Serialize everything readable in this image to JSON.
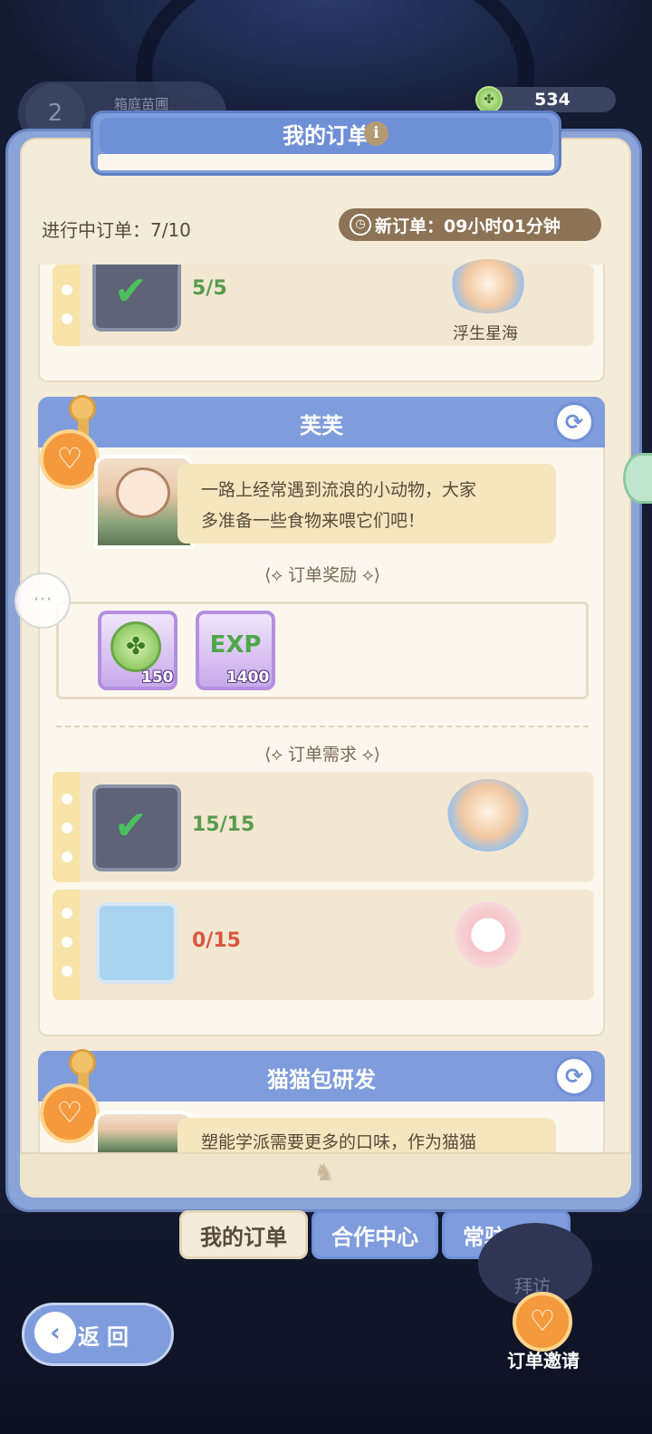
{
  "header": {
    "level": "2",
    "level_name": "箱庭苗圃",
    "currency_value": "534",
    "title": "我的订单",
    "info_label": "i"
  },
  "status": {
    "in_progress": "进行中订单：7/10",
    "new_order_timer": "新订单：09小时01分钟"
  },
  "top_card": {
    "requirement_count": "5/5",
    "giver_name": "浮生星海"
  },
  "order_card": {
    "title": "芙芙",
    "message_line1": "一路上经常遇到流浪的小动物，大家",
    "message_line2": "多准备一些食物来喂它们吧！",
    "reward_section_label": "订单奖励",
    "rewards": [
      {
        "icon": "clover-coin-icon",
        "quantity": "150"
      },
      {
        "icon": "exp-clover-icon",
        "label": "EXP",
        "quantity": "1400"
      }
    ],
    "requirement_section_label": "订单需求",
    "requirements": [
      {
        "icon": "turnip-icon",
        "count": "15/15",
        "complete": true
      },
      {
        "icon": "salad-dish-icon",
        "count": "0/15",
        "complete": false
      }
    ]
  },
  "next_card": {
    "title": "猫猫包研发",
    "message_partial": "塑能学派需要更多的口味，作为猫猫"
  },
  "tabs": [
    {
      "label": "我的订单",
      "active": true
    },
    {
      "label": "合作中心",
      "active": false
    },
    {
      "label": "常驻收购",
      "active": false
    }
  ],
  "visit_label": "拜访",
  "back_label": "返回",
  "invite_label": "订单邀请",
  "colors": {
    "accent_blue": "#7f9cdc",
    "panel_cream": "#f4ecd9",
    "complete_green": "#5a9a4e",
    "incomplete_red": "#d9573e",
    "badge_orange": "#f49a3c"
  }
}
